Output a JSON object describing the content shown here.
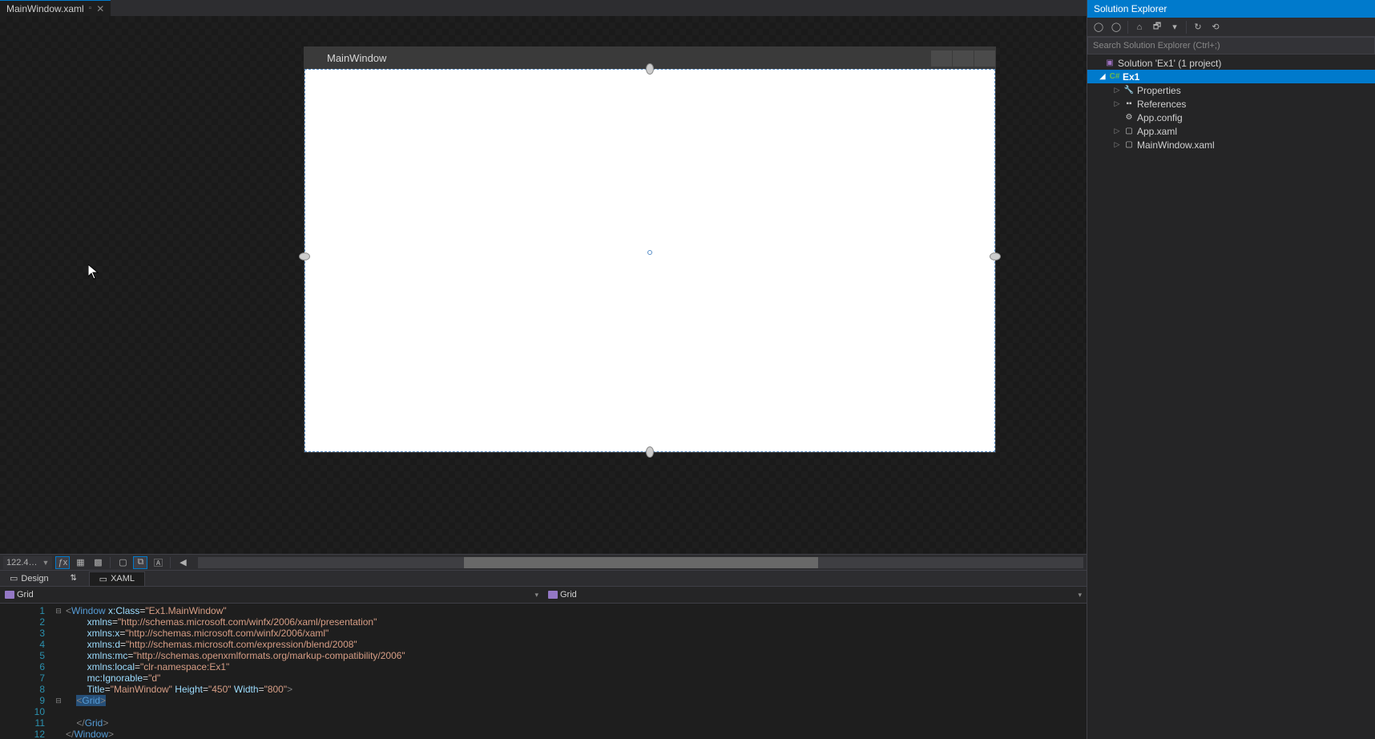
{
  "tab": {
    "name": "MainWindow.xaml",
    "preview_glyph": "▫",
    "close_glyph": "✕"
  },
  "designer": {
    "window_title": "MainWindow"
  },
  "toolbar": {
    "zoom": "122.4…"
  },
  "view_tabs": {
    "design": "Design",
    "swap": "⇅",
    "xaml": "XAML"
  },
  "breadcrumb": {
    "left": "Grid",
    "right": "Grid"
  },
  "code": {
    "lines": [
      {
        "n": "1",
        "fold": "⊟",
        "html": "<span class='ang'>&lt;</span><span class='tag'>Window</span> <span class='attr'>x:Class</span>=<span class='str'>\"Ex1.MainWindow\"</span>"
      },
      {
        "n": "2",
        "fold": "",
        "html": "        <span class='attr'>xmlns</span>=<span class='str'>\"http://schemas.microsoft.com/winfx/2006/xaml/presentation\"</span>"
      },
      {
        "n": "3",
        "fold": "",
        "html": "        <span class='attr'>xmlns:x</span>=<span class='str'>\"http://schemas.microsoft.com/winfx/2006/xaml\"</span>"
      },
      {
        "n": "4",
        "fold": "",
        "html": "        <span class='attr'>xmlns:d</span>=<span class='str'>\"http://schemas.microsoft.com/expression/blend/2008\"</span>"
      },
      {
        "n": "5",
        "fold": "",
        "html": "        <span class='attr'>xmlns:mc</span>=<span class='str'>\"http://schemas.openxmlformats.org/markup-compatibility/2006\"</span>"
      },
      {
        "n": "6",
        "fold": "",
        "html": "        <span class='attr'>xmlns:local</span>=<span class='str'>\"clr-namespace:Ex1\"</span>"
      },
      {
        "n": "7",
        "fold": "",
        "html": "        <span class='attr'>mc:Ignorable</span>=<span class='str'>\"d\"</span>"
      },
      {
        "n": "8",
        "fold": "",
        "html": "        <span class='attr'>Title</span>=<span class='str'>\"MainWindow\"</span> <span class='attr'>Height</span>=<span class='str'>\"450\"</span> <span class='attr'>Width</span>=<span class='str'>\"800\"</span><span class='ang'>&gt;</span>"
      },
      {
        "n": "9",
        "fold": "⊟",
        "html": "    <span class='sel'><span class='ang'>&lt;</span><span class='tag'>Grid</span><span class='ang'>&gt;</span></span>"
      },
      {
        "n": "10",
        "fold": "",
        "html": "        "
      },
      {
        "n": "11",
        "fold": "",
        "html": "    <span class='ang'>&lt;/</span><span class='tag'>Grid</span><span class='ang'>&gt;</span>"
      },
      {
        "n": "12",
        "fold": "",
        "html": "<span class='ang'>&lt;/</span><span class='tag'>Window</span><span class='ang'>&gt;</span>"
      }
    ]
  },
  "solution_explorer": {
    "title": "Solution Explorer",
    "search_placeholder": "Search Solution Explorer (Ctrl+;)",
    "tree": {
      "solution": "Solution 'Ex1' (1 project)",
      "project": "Ex1",
      "items": [
        {
          "label": "Properties",
          "icon": "wrench",
          "expandable": true
        },
        {
          "label": "References",
          "icon": "ref",
          "expandable": true
        },
        {
          "label": "App.config",
          "icon": "cfg",
          "expandable": false
        },
        {
          "label": "App.xaml",
          "icon": "xaml",
          "expandable": true
        },
        {
          "label": "MainWindow.xaml",
          "icon": "xaml",
          "expandable": true
        }
      ]
    }
  }
}
